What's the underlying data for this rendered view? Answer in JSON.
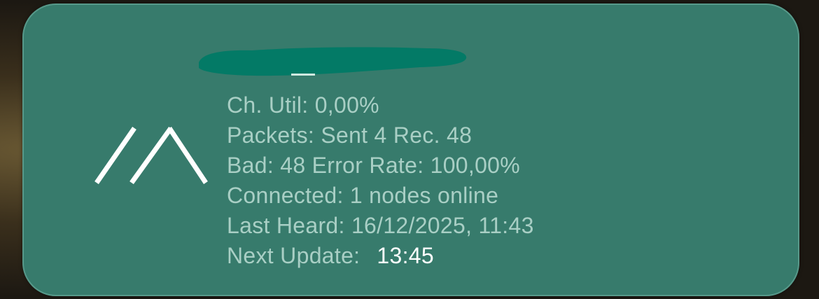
{
  "widget": {
    "device_name": "",
    "stats": [
      {
        "label": "Ch. Util:",
        "value": "0,00%"
      },
      {
        "label": "Packets:",
        "value": "Sent 4 Rec. 48"
      },
      {
        "label": "Bad:",
        "value": "48 Error Rate: 100,00%"
      },
      {
        "label": "Connected:",
        "value": "1 nodes online"
      },
      {
        "label": "Last Heard:",
        "value": "16/12/2025, 11:43"
      }
    ],
    "next_update": {
      "label": "Next Update:",
      "value": "13:45"
    },
    "logo_icon": "meshtastic-logo-icon",
    "colors": {
      "card": "#377b6c",
      "text": "#a9cfc5",
      "highlight": "#ffffff",
      "redaction": "#037a66"
    }
  }
}
